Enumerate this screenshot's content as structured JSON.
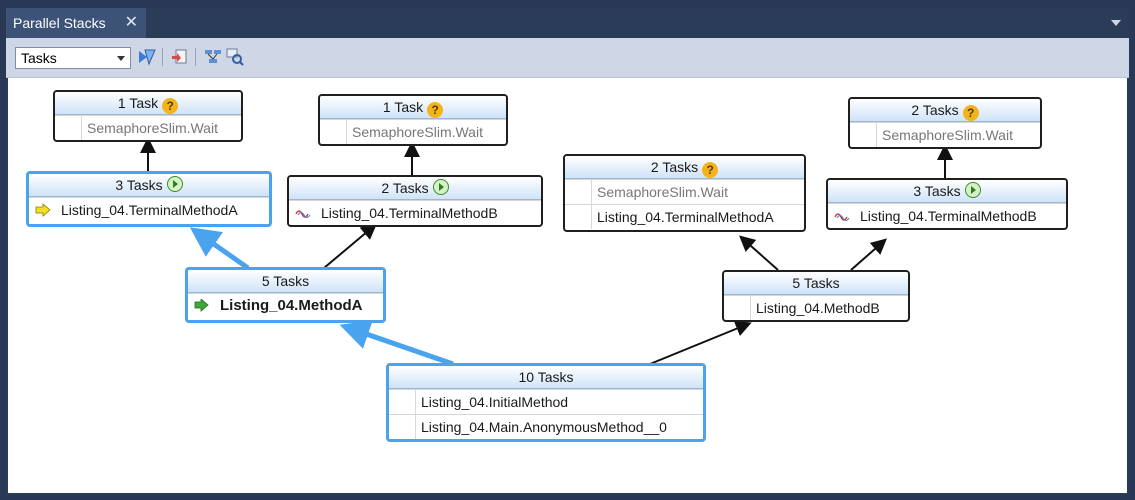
{
  "window": {
    "tab_title": "Parallel Stacks",
    "tab_close": "✕"
  },
  "toolbar": {
    "view_combo_value": "Tasks"
  },
  "icons": {
    "question": "?",
    "play": "status-running-icon",
    "current_arrow": "current-thread-arrow-icon",
    "thread_switch": "thread-switch-icon",
    "wave": "context-switch-wave-icon"
  },
  "nodes": [
    {
      "id": "n1",
      "header": "1 Task",
      "rows": [
        "SemaphoreSlim.Wait"
      ]
    },
    {
      "id": "n2",
      "header": "1 Task",
      "rows": [
        "SemaphoreSlim.Wait"
      ]
    },
    {
      "id": "n3",
      "header": "2 Tasks",
      "rows": [
        "SemaphoreSlim.Wait"
      ]
    },
    {
      "id": "n4",
      "header": "3 Tasks",
      "rows": [
        "Listing_04.TerminalMethodA"
      ]
    },
    {
      "id": "n5",
      "header": "2 Tasks",
      "rows": [
        "Listing_04.TerminalMethodB"
      ]
    },
    {
      "id": "n6",
      "header": "2 Tasks",
      "rows": [
        "SemaphoreSlim.Wait",
        "Listing_04.TerminalMethodA"
      ]
    },
    {
      "id": "n7",
      "header": "3 Tasks",
      "rows": [
        "Listing_04.TerminalMethodB"
      ]
    },
    {
      "id": "n8",
      "header": "5 Tasks",
      "rows": [
        "Listing_04.MethodA"
      ]
    },
    {
      "id": "n9",
      "header": "5 Tasks",
      "rows": [
        "Listing_04.MethodB"
      ]
    },
    {
      "id": "n10",
      "header": "10 Tasks",
      "rows": [
        "Listing_04.InitialMethod",
        "Listing_04.Main.AnonymousMethod__0"
      ]
    }
  ],
  "colors": {
    "selected_border": "#4aa3ee",
    "toolbar_bg": "#cfd6e5",
    "chrome_bg": "#2b3c59"
  }
}
